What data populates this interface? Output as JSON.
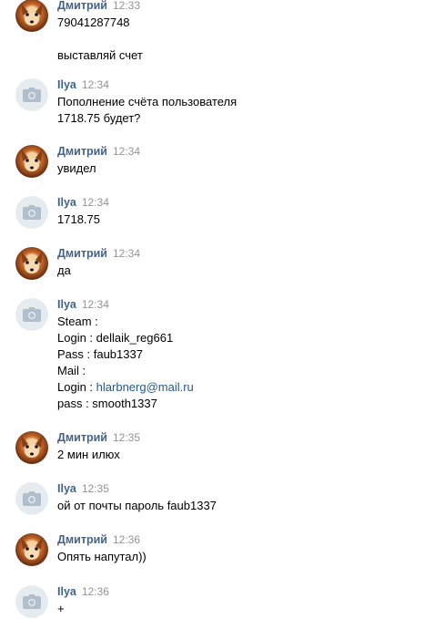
{
  "messages": [
    {
      "author": "Дмитрий",
      "time": "12:33",
      "avatar": "fox-avatar",
      "lines": [
        "79041287748",
        "",
        "выставляй счет"
      ]
    },
    {
      "author": "Ilya",
      "time": "12:34",
      "avatar": "camera-avatar",
      "lines": [
        "Пополнение счёта пользователя",
        "1718.75 будет?"
      ]
    },
    {
      "author": "Дмитрий",
      "time": "12:34",
      "avatar": "fox-avatar",
      "lines": [
        "увидел"
      ]
    },
    {
      "author": "Ilya",
      "time": "12:34",
      "avatar": "camera-avatar",
      "lines": [
        "1718.75"
      ]
    },
    {
      "author": "Дмитрий",
      "time": "12:34",
      "avatar": "fox-avatar",
      "lines": [
        "да"
      ]
    },
    {
      "author": "Ilya",
      "time": "12:34",
      "avatar": "camera-avatar",
      "lines": [
        "Steam :",
        "Login : dellaik_reg661",
        "Pass : faub1337",
        "Mail :",
        "Login : ",
        "pass : smooth1337"
      ],
      "email_link": "hlarbnerg@mail.ru"
    },
    {
      "author": "Дмитрий",
      "time": "12:35",
      "avatar": "fox-avatar",
      "lines": [
        "2 мин илюх"
      ]
    },
    {
      "author": "Ilya",
      "time": "12:35",
      "avatar": "camera-avatar",
      "lines": [
        "ой от почты пароль faub1337"
      ]
    },
    {
      "author": "Дмитрий",
      "time": "12:36",
      "avatar": "fox-avatar",
      "lines": [
        "Опять напутал))"
      ]
    },
    {
      "author": "Ilya",
      "time": "12:36",
      "avatar": "camera-avatar",
      "lines": [
        "+"
      ]
    }
  ],
  "colors": {
    "author": "#42648b",
    "time": "#939393",
    "text": "#000000",
    "link": "#2a5885"
  }
}
